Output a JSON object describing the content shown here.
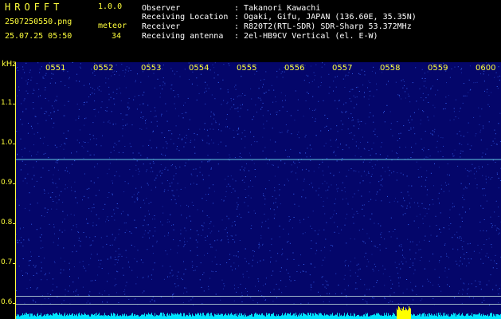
{
  "header": {
    "app_title": "HROFFT",
    "app_version": "1.0.0",
    "filename": "2507250550.png",
    "datetime": "25.07.25 05:50",
    "meteor_label": "meteor",
    "meteor_count": "34"
  },
  "info": [
    {
      "key": "Observer",
      "sep": ":",
      "value": "Takanori Kawachi"
    },
    {
      "key": "Receiving Location",
      "sep": ":",
      "value": "Ogaki, Gifu, JAPAN (136.60E, 35.35N)"
    },
    {
      "key": "Receiver",
      "sep": ":",
      "value": "R820T2(RTL-SDR) SDR-Sharp 53.372MHz"
    },
    {
      "key": "Receiving antenna",
      "sep": ":",
      "value": "2el-HB9CV Vertical (el. E-W)"
    }
  ],
  "spectrogram": {
    "y_unit": "kHz",
    "y_ticks": [
      "1.1",
      "1.0",
      "0.9",
      "0.8",
      "0.7",
      "0.6"
    ],
    "x_ticks": [
      "0551",
      "0552",
      "0553",
      "0554",
      "0555",
      "0556",
      "0557",
      "0558",
      "0559",
      "0600"
    ],
    "signal_freq_khz": 0.96,
    "colors": {
      "background": "#04066a",
      "noise": "#3d6dff",
      "signal": "#7fffff",
      "bars": "#00e5ff",
      "bar_peak": "#ffff00",
      "axis": "#ffff3c"
    }
  }
}
